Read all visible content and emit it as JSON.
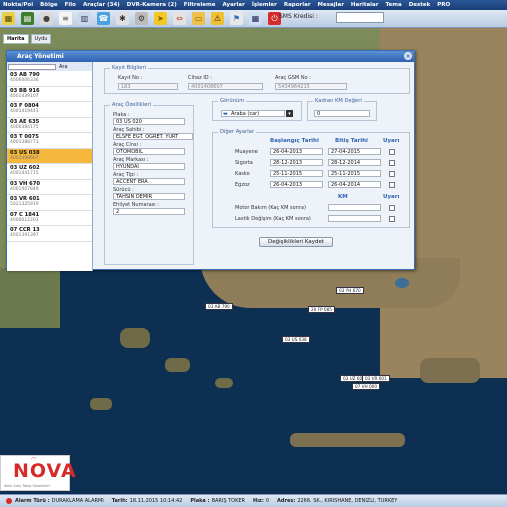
{
  "menu": [
    "Nokta/Poi",
    "Bölge",
    "Filo",
    "Araçlar (34)",
    "DVR-Kamera (2)",
    "Filtreleme",
    "Ayarlar",
    "İşlemler",
    "Raporlar",
    "Mesajlar",
    "Haritalar",
    "Tema",
    "Destek",
    "PRO"
  ],
  "toolbar": {
    "sms_label": "SMS Kredisi :",
    "sms_value": "0"
  },
  "map_tabs": [
    "Harita",
    "Uydu"
  ],
  "dialog": {
    "title": "Araç Yönetimi",
    "search_button": "Ara",
    "vehicles": [
      {
        "plate": "03 AB 790",
        "device": "4006006336"
      },
      {
        "plate": "03 BB 916",
        "device": "4001439107"
      },
      {
        "plate": "03 F 0804",
        "device": "4001419441"
      },
      {
        "plate": "03 AE 635",
        "device": "4000384175"
      },
      {
        "plate": "03 T 0075",
        "device": "4001388773"
      },
      {
        "plate": "03 US 038",
        "device": "4001408607"
      },
      {
        "plate": "03 UZ 602",
        "device": "4001441715"
      },
      {
        "plate": "03 VH 670",
        "device": "4001407849"
      },
      {
        "plate": "03 VR 601",
        "device": "5021325919"
      },
      {
        "plate": "07 C 1841",
        "device": "4006012203"
      },
      {
        "plate": "07 CCR 13",
        "device": "4001391397"
      }
    ],
    "kayit": {
      "legend": "Kayıt Bilgileri",
      "arac_no_label": "Kayıt No :",
      "arac_no": "183",
      "cihaz_id_label": "Cihaz ID :",
      "cihaz_id": "4001408607",
      "gsm_label": "Araç GSM No :",
      "gsm": "5434964215"
    },
    "ozellik": {
      "legend": "Araç Özellikleri",
      "plaka_label": "Plaka :",
      "plaka": "03 US 020",
      "sahibi_label": "Araç Sahibi :",
      "sahibi": "ELSFE EĞT. ÖĞRET. YURT",
      "cinsi_label": "Araç Cinsi :",
      "cinsi": "OTOMOBİL",
      "markasi_label": "Araç Markası :",
      "markasi": "HYUNDAI",
      "tipi_label": "Araç Tipi :",
      "tipi": "ACCENT ERA",
      "surucu_label": "Sürücü :",
      "surucu": "TAHSİN DEMİR",
      "ehliyet_label": "Ehliyet Numarası :",
      "ehliyet": "2"
    },
    "gorunum": {
      "legend": "Görünüm",
      "value": "Araba (car)"
    },
    "kadran": {
      "legend": "Kadran KM Değeri",
      "value": "0"
    },
    "diger": {
      "legend": "Diğer Ayarlar",
      "col_start": "Başlangıç Tarihi",
      "col_end": "Bitiş Tarihi",
      "col_alert": "Uyarı",
      "rows": [
        {
          "label": "Muayene",
          "start": "26-04-2013",
          "end": "27-04-2015"
        },
        {
          "label": "Sigorta",
          "start": "28-12-2013",
          "end": "28-12-2014"
        },
        {
          "label": "Kasko",
          "start": "25-11-2015",
          "end": "25-11-2015"
        },
        {
          "label": "Egzoz",
          "start": "26-04-2013",
          "end": "26-04-2014"
        }
      ],
      "km_header": "KM",
      "km_alert_header": "Uyarı",
      "motor_label": "Motor Bakım (Kaç KM sonra)",
      "lastik_label": "Lastik Değişim (Kaç KM sonra)"
    },
    "save_button": "Değişiklikleri Kaydet"
  },
  "markers": [
    "03 YH 670",
    "20 FP 085",
    "03 AB 790",
    "03 US 038",
    "03 UZ 602",
    "03 VR 601",
    "07 VH 000"
  ],
  "logo": {
    "text": "NOVA",
    "subtitle": "Akıllı Araç Takip Sistemleri"
  },
  "status": {
    "alarm_label": "Alarm Türü :",
    "alarm": "DURAKLAMA ALARMI",
    "tarih_label": "Tarih:",
    "tarih": "18.11.2015 10:14:42",
    "plaka_label": "Plaka :",
    "plaka": "BARIŞ TOKER",
    "hiz_label": "Hız:",
    "hiz": "0",
    "adres_label": "Adres:",
    "adres": "2266. SK., KIRISHANE, DENIZLI, TURKEY"
  }
}
